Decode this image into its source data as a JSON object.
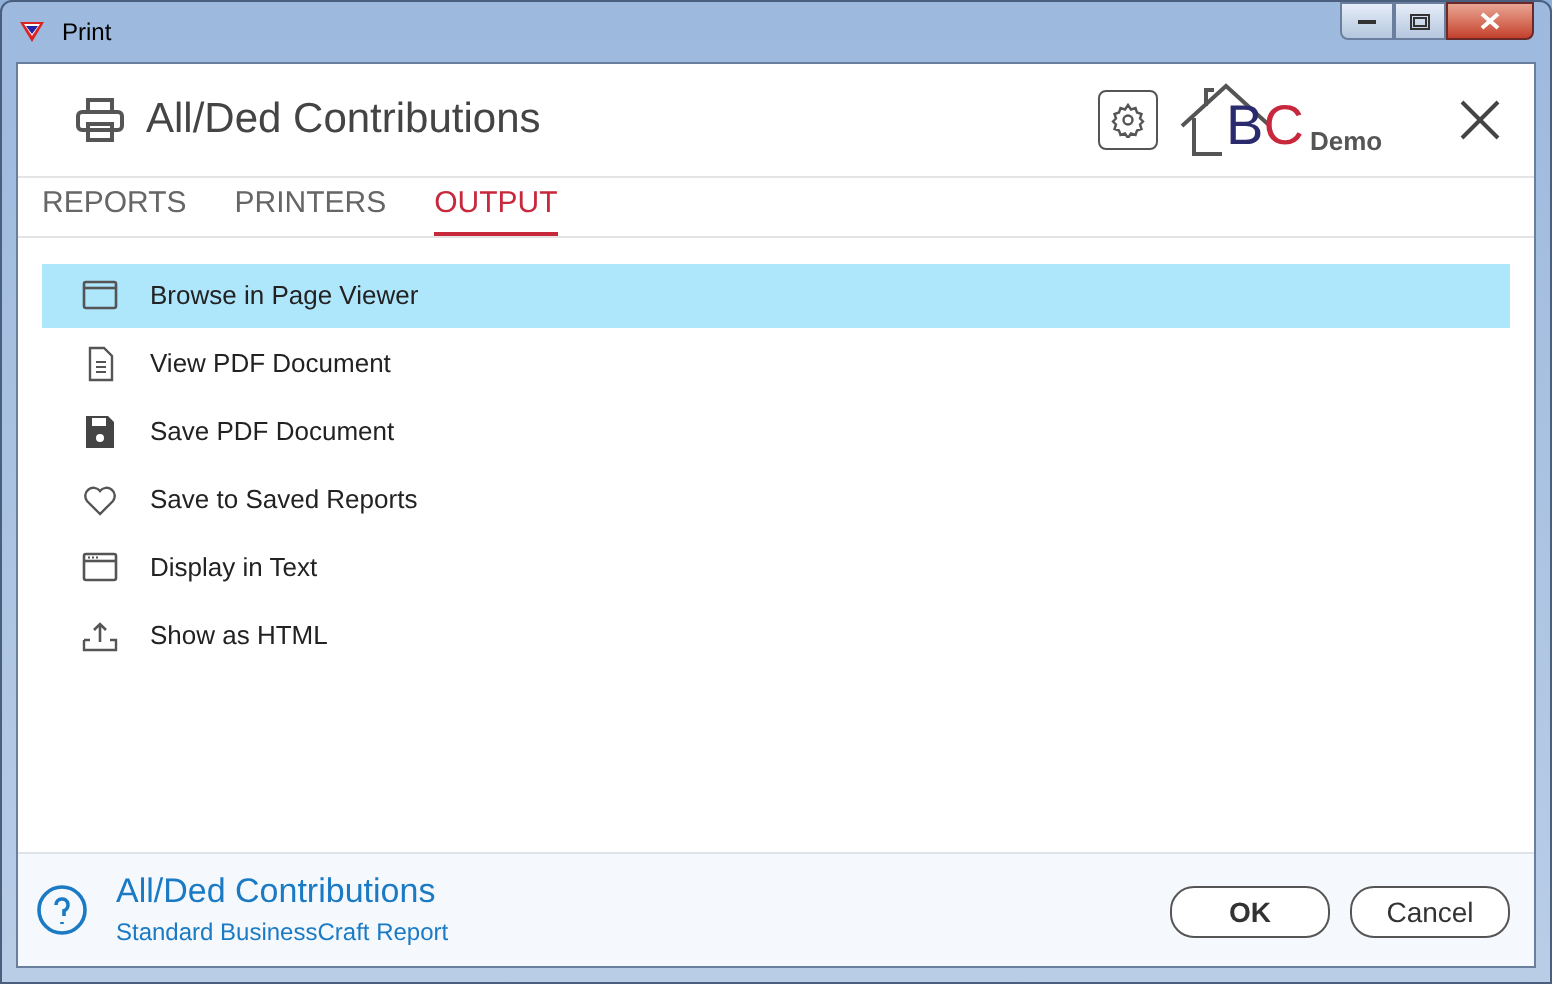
{
  "window": {
    "title": "Print"
  },
  "header": {
    "title": "All/Ded Contributions",
    "logo": {
      "letter_1": "B",
      "letter_2": "C",
      "caption": "Demo"
    }
  },
  "tabs": [
    {
      "label": "REPORTS",
      "selected": false
    },
    {
      "label": "PRINTERS",
      "selected": false
    },
    {
      "label": "OUTPUT",
      "selected": true
    }
  ],
  "outputs": [
    {
      "kind": "browser",
      "label": "Browse in Page Viewer",
      "selected": true
    },
    {
      "kind": "document",
      "label": "View PDF Document",
      "selected": false
    },
    {
      "kind": "disk",
      "label": "Save PDF Document",
      "selected": false
    },
    {
      "kind": "heart",
      "label": "Save to Saved Reports",
      "selected": false
    },
    {
      "kind": "text",
      "label": "Display in Text",
      "selected": false
    },
    {
      "kind": "export",
      "label": "Show as HTML",
      "selected": false
    }
  ],
  "footer": {
    "title": "All/Ded Contributions",
    "subtitle": "Standard BusinessCraft Report"
  },
  "buttons": [
    "OK",
    "Cancel"
  ]
}
